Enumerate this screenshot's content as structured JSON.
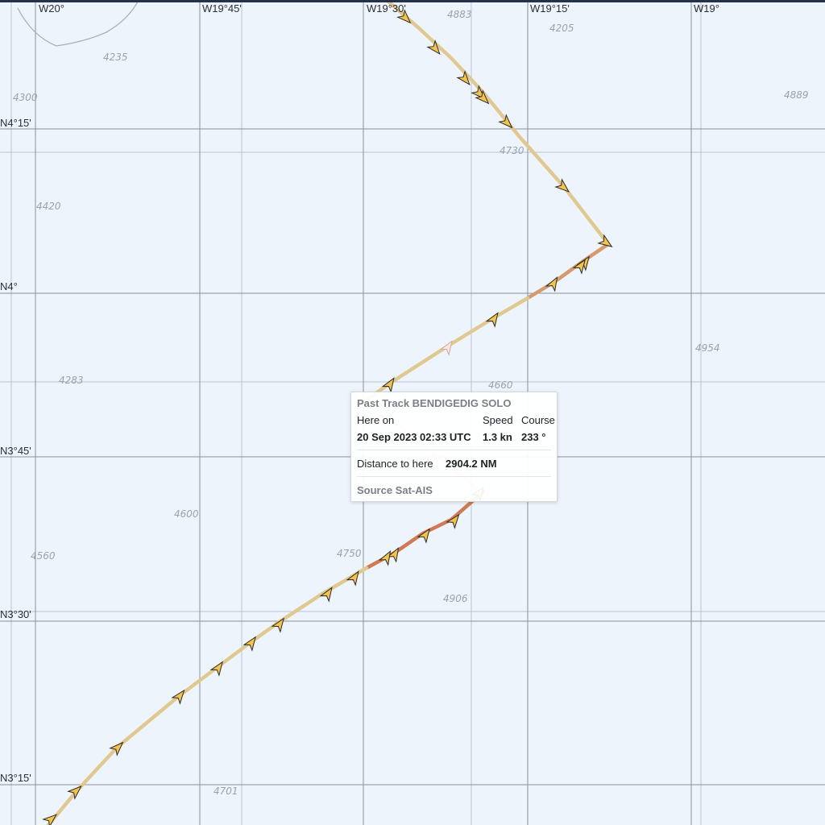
{
  "map": {
    "lon_labels": [
      "W20°",
      "W19°45'",
      "W19°30'",
      "W19°15'",
      "W19°"
    ],
    "lat_labels": [
      "N4°15'",
      "N4°",
      "N3°45'",
      "N3°30'",
      "N3°15'"
    ],
    "depths": [
      "4883",
      "4205",
      "4235",
      "4300",
      "4889",
      "4730",
      "4420",
      "4954",
      "4283",
      "4660",
      "4600",
      "4750",
      "4560",
      "4906",
      "4701"
    ],
    "colors": {
      "background": "#eef4fc",
      "graticule": "#8a909a",
      "track_normal": "#e0c990",
      "track_slow": "#d08a5e",
      "arrow_fill": "#f2c44e",
      "arrow_outline": "#2b2b2b"
    }
  },
  "popup": {
    "title": "Past Track BENDIGEDIG SOLO",
    "here_on_label": "Here on",
    "speed_label": "Speed",
    "course_label": "Course",
    "datetime": "20 Sep 2023 02:33 UTC",
    "speed": "1.3 kn",
    "course": "233 °",
    "distance_label": "Distance to here",
    "distance": "2904.2 NM",
    "source": "Source Sat-AIS"
  }
}
